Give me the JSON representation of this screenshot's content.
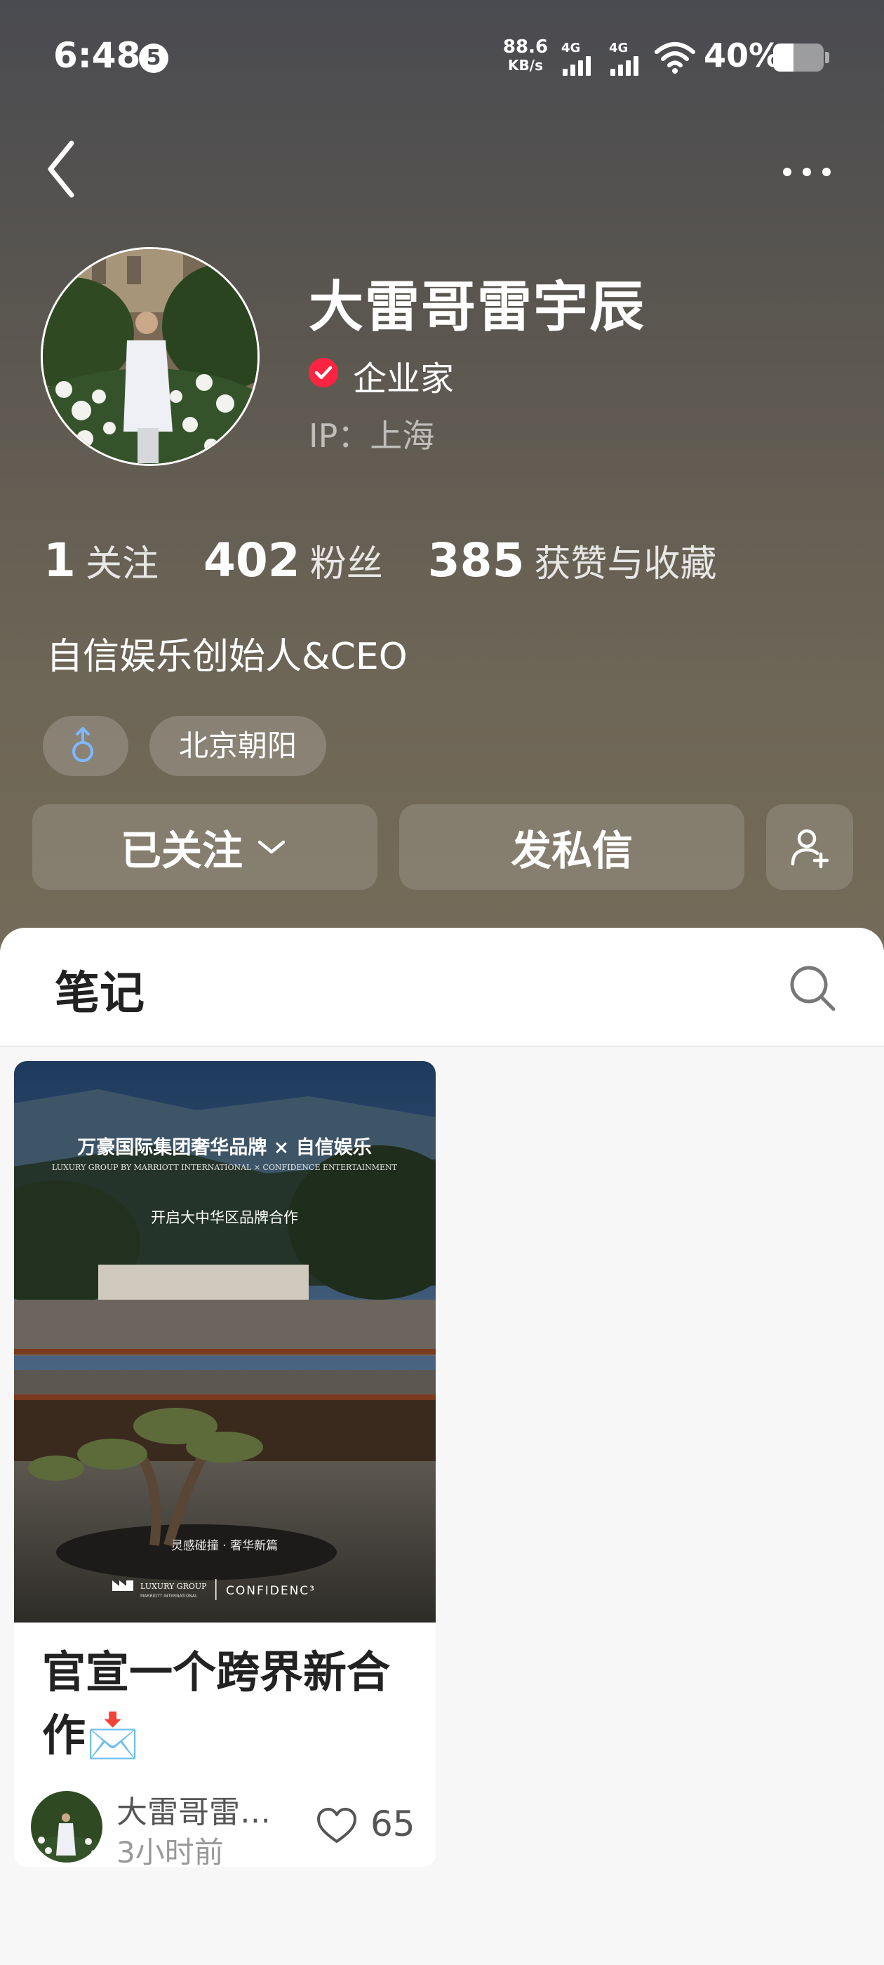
{
  "status_bar": {
    "time": "6:48",
    "notification_count": "5",
    "net_speed_value": "88.6",
    "net_speed_unit": "KB/s",
    "sim1_label": "4G",
    "sim2_label": "4G",
    "battery_percent_text": "40%",
    "battery_level": 0.4
  },
  "profile": {
    "name": "大雷哥雷宇辰",
    "verified_title": "企业家",
    "ip_location": "IP：上海",
    "stats": [
      {
        "num": "1",
        "label": "关注"
      },
      {
        "num": "402",
        "label": "粉丝"
      },
      {
        "num": "385",
        "label": "获赞与收藏"
      }
    ],
    "bio": "自信娱乐创始人&CEO",
    "gender_icon": "male-icon",
    "location_tag": "北京朝阳"
  },
  "actions": {
    "follow_label": "已关注",
    "message_label": "发私信"
  },
  "tabs": {
    "notes_label": "笔记"
  },
  "note": {
    "cover_text": {
      "headline": "万豪国际集团奢华品牌 × 自信娱乐",
      "subline": "LUXURY GROUP BY MARRIOTT INTERNATIONAL × CONFIDENCE ENTERTAINMENT",
      "tagline": "开启大中华区品牌合作",
      "bottom_caption": "灵感碰撞 · 奢华新篇",
      "brand_left": "LUXURY GROUP",
      "brand_left_sub": "MARRIOTT INTERNATIONAL",
      "brand_right": "CONFIDENC³"
    },
    "title": "官宣一个跨界新合作📩",
    "author": "大雷哥雷宇辰",
    "time": "3小时前",
    "likes": "65"
  },
  "colors": {
    "accent_red": "#ff2442",
    "gender_blue": "#7fb8ff"
  }
}
